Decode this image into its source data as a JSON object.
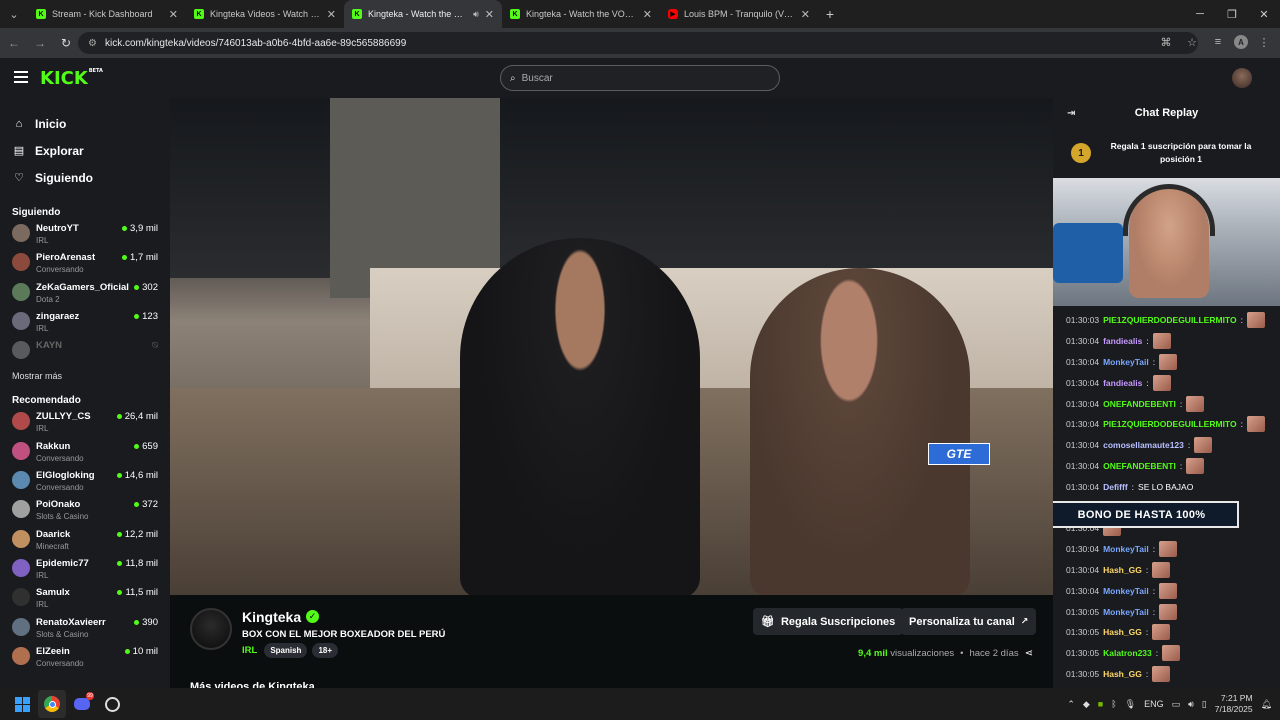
{
  "browser": {
    "tabs": [
      {
        "title": "Stream - Kick Dashboard",
        "icon": "kick-icon",
        "active": false
      },
      {
        "title": "Kingteka Videos - Watch On-De",
        "icon": "kick-icon",
        "active": false
      },
      {
        "title": "Kingteka - Watch the VOD o",
        "icon": "kick-icon",
        "active": true
      },
      {
        "title": "Kingteka - Watch the VOD on K",
        "icon": "kick-icon",
        "active": false
      },
      {
        "title": "Louis BPM - Tranquilo (Video O",
        "icon": "youtube-icon",
        "active": false
      }
    ],
    "url": "kick.com/kingteka/videos/746013ab-a0b6-4bfd-aa6e-89c565886699"
  },
  "header": {
    "logo": "KICK",
    "logo_badge": "BETA",
    "search_placeholder": "Buscar"
  },
  "sidebar": {
    "nav": [
      {
        "label": "Inicio",
        "icon": "home-icon"
      },
      {
        "label": "Explorar",
        "icon": "explore-icon"
      },
      {
        "label": "Siguiendo",
        "icon": "heart-icon"
      }
    ],
    "following_title": "Siguiendo",
    "following": [
      {
        "name": "NeutroYT",
        "category": "IRL",
        "viewers": "3,9 mil",
        "live": true
      },
      {
        "name": "PieroArenast",
        "category": "Conversando",
        "viewers": "1,7 mil",
        "live": true
      },
      {
        "name": "ZeKaGamers_Oficial",
        "category": "Dota 2",
        "viewers": "302",
        "live": true
      },
      {
        "name": "zingaraez",
        "category": "IRL",
        "viewers": "123",
        "live": true
      },
      {
        "name": "KAYN",
        "category": "",
        "viewers": "",
        "live": false
      }
    ],
    "show_more": "Mostrar más",
    "recommended_title": "Recomendado",
    "recommended": [
      {
        "name": "ZULLYY_CS",
        "category": "IRL",
        "viewers": "26,4 mil"
      },
      {
        "name": "Rakkun",
        "category": "Conversando",
        "viewers": "659"
      },
      {
        "name": "ElGlogloking",
        "category": "Conversando",
        "viewers": "14,6 mil"
      },
      {
        "name": "PoiOnako",
        "category": "Slots & Casino",
        "viewers": "372"
      },
      {
        "name": "Daarick",
        "category": "Minecraft",
        "viewers": "12,2 mil"
      },
      {
        "name": "Epidemic77",
        "category": "IRL",
        "viewers": "11,8 mil"
      },
      {
        "name": "Samulx",
        "category": "IRL",
        "viewers": "11,5 mil"
      },
      {
        "name": "RenatoXavieerr",
        "category": "Slots & Casino",
        "viewers": "390"
      },
      {
        "name": "ElZeein",
        "category": "Conversando",
        "viewers": "10 mil"
      }
    ]
  },
  "video": {
    "overlay_tag": "GTE"
  },
  "channel": {
    "name": "Kingteka",
    "title": "BOX CON EL MEJOR BOXEADOR DEL PERÚ",
    "category": "IRL",
    "language": "Spanish",
    "rating": "18+",
    "gift_button": "Regala Suscripciones",
    "customize_button": "Personaliza tu canal",
    "views_count": "9,4 mil",
    "views_label": "visualizaciones",
    "ago": "hace 2 días",
    "more_videos": "Más videos de Kingteka"
  },
  "chat": {
    "title": "Chat Replay",
    "pinned_rank": "1",
    "pinned_text": "Regala 1 suscripción para tomar la posición 1",
    "bono_overlay": "BONO DE HASTA 100%",
    "messages": [
      {
        "time": "01:30:03",
        "user": "PIE1ZQUIERDODEGUILLERMITO",
        "color": "#53fc18",
        "text": "",
        "emote": true
      },
      {
        "time": "01:30:04",
        "user": "fandiealis",
        "color": "#c79bff",
        "text": "",
        "emote": true
      },
      {
        "time": "01:30:04",
        "user": "MonkeyTail",
        "color": "#7aa8ff",
        "text": "",
        "emote": true
      },
      {
        "time": "01:30:04",
        "user": "fandiealis",
        "color": "#c79bff",
        "text": "",
        "emote": true
      },
      {
        "time": "01:30:04",
        "user": "ONEFANDEBENTI",
        "color": "#53fc18",
        "text": "",
        "emote": true
      },
      {
        "time": "01:30:04",
        "user": "PIE1ZQUIERDODEGUILLERMITO",
        "color": "#53fc18",
        "text": "",
        "emote": true
      },
      {
        "time": "01:30:04",
        "user": "comosellamaute123",
        "color": "#b8c0ff",
        "text": "",
        "emote": true
      },
      {
        "time": "01:30:04",
        "user": "ONEFANDEBENTI",
        "color": "#53fc18",
        "text": "",
        "emote": true
      },
      {
        "time": "01:30:04",
        "user": "Defifff",
        "color": "#b8c0ff",
        "text": "SE LO BAJAO",
        "emote": false
      },
      {
        "time": "",
        "user": "",
        "color": "#fff",
        "text": "",
        "emote": false
      },
      {
        "time": "01:30:04",
        "user": "",
        "color": "#fff",
        "text": "",
        "emote": true
      },
      {
        "time": "01:30:04",
        "user": "MonkeyTail",
        "color": "#7aa8ff",
        "text": "",
        "emote": true
      },
      {
        "time": "01:30:04",
        "user": "Hash_GG",
        "color": "#ffd86b",
        "text": "",
        "emote": true
      },
      {
        "time": "01:30:04",
        "user": "MonkeyTail",
        "color": "#7aa8ff",
        "text": "",
        "emote": true
      },
      {
        "time": "01:30:05",
        "user": "MonkeyTail",
        "color": "#7aa8ff",
        "text": "",
        "emote": true
      },
      {
        "time": "01:30:05",
        "user": "Hash_GG",
        "color": "#ffd86b",
        "text": "",
        "emote": true
      },
      {
        "time": "01:30:05",
        "user": "Kalatron233",
        "color": "#53fc18",
        "text": "",
        "emote": true
      },
      {
        "time": "01:30:05",
        "user": "Hash_GG",
        "color": "#ffd86b",
        "text": "",
        "emote": true
      }
    ]
  },
  "taskbar": {
    "discord_badge": "99",
    "lang": "ENG",
    "time": "7:21 PM",
    "date": "7/18/2025"
  }
}
